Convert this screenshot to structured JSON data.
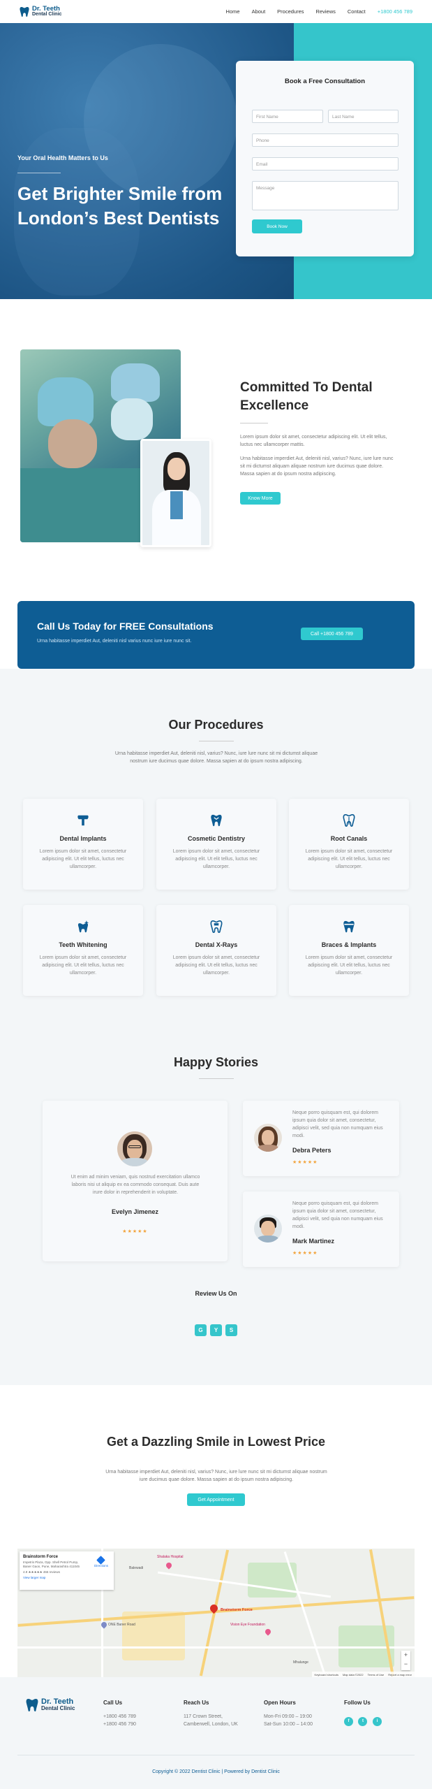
{
  "brand": {
    "name": "Dr. Teeth",
    "sub": "Dental Clinic"
  },
  "nav": {
    "items": [
      "Home",
      "About",
      "Procedures",
      "Reviews",
      "Contact"
    ],
    "phone": "+1800 456 789"
  },
  "hero": {
    "kicker": "Your Oral Health Matters to Us",
    "title": "Get Brighter Smile from London’s Best Dentists",
    "form": {
      "title": "Book a Free Consultation",
      "first_name": "First Name",
      "last_name": "Last Name",
      "phone": "Phone",
      "email": "Email",
      "message": "Message",
      "button": "Book Now"
    }
  },
  "commit": {
    "title": "Committed To Dental Excellence",
    "p1": "Lorem ipsum dolor sit amet, consectetur adipiscing elit. Ut elit tellus, luctus nec ullamcorper mattis.",
    "p2": "Urna habitasse imperdiet Aut, deleniti nisl, varius? Nunc, iure lure nunc sit mi dictumst aliquam aliquae nostrum iure ducimus quae dolore. Massa sapien at do ipsum nostra adipiscing.",
    "button": "Know More"
  },
  "cta": {
    "title": "Call Us Today for FREE Consultations",
    "sub": "Urna habitasse imperdiet Aut, deleniti nisl varius nunc iure iure nunc sit.",
    "button": "Call +1800 456 789"
  },
  "procedures": {
    "title": "Our Procedures",
    "sub": "Urna habitasse imperdiet Aut, deleniti nisl, varius? Nunc, iure lure nunc sit mi dictumst aliquae nostrum iure ducimus quae dolore. Massa sapien at do ipsum nostra adipiscing.",
    "items": [
      {
        "title": "Dental Implants",
        "text": "Lorem ipsum dolor sit amet, consectetur adipiscing elit. Ut elit tellus, luctus nec ullamcorper."
      },
      {
        "title": "Cosmetic Dentistry",
        "text": "Lorem ipsum dolor sit amet, consectetur adipiscing elit. Ut elit tellus, luctus nec ullamcorper."
      },
      {
        "title": "Root Canals",
        "text": "Lorem ipsum dolor sit amet, consectetur adipiscing elit. Ut elit tellus, luctus nec ullamcorper."
      },
      {
        "title": "Teeth Whitening",
        "text": "Lorem ipsum dolor sit amet, consectetur adipiscing elit. Ut elit tellus, luctus nec ullamcorper."
      },
      {
        "title": "Dental X-Rays",
        "text": "Lorem ipsum dolor sit amet, consectetur adipiscing elit. Ut elit tellus, luctus nec ullamcorper."
      },
      {
        "title": "Braces & Implants",
        "text": "Lorem ipsum dolor sit amet, consectetur adipiscing elit. Ut elit tellus, luctus nec ullamcorper."
      }
    ]
  },
  "stories": {
    "title": "Happy Stories",
    "main": {
      "quote": "Ut enim ad minim veniam, quis nostrud exercitation ullamco laboris nisi ut aliquip ex ea commodo consequat. Duis aute irure dolor in reprehenderit in voluptate.",
      "name": "Evelyn Jimenez",
      "stars": "★★★★★"
    },
    "side": [
      {
        "quote": "Neque porro quisquam est, qui dolorem ipsum quia dolor sit amet, consectetur, adipisci velit, sed quia non numquam eius modi.",
        "name": "Debra Peters",
        "stars": "★★★★★"
      },
      {
        "quote": "Neque porro quisquam est, qui dolorem ipsum quia dolor sit amet, consectetur, adipisci velit, sed quia non numquam eius modi.",
        "name": "Mark Martinez",
        "stars": "★★★★★"
      }
    ],
    "review_title": "Review Us On",
    "review_icons": [
      "G",
      "Y",
      "S"
    ]
  },
  "dazzle": {
    "title": "Get a Dazzling Smile in Lowest Price",
    "sub": "Urna habitasse imperdiet Aut, deleniti nisl, varius? Nunc, iure lure nunc sit mi dictumst aliquae nostrum iure ducimus quae dolore. Massa sapien at do ipsum nostra adipiscing.",
    "button": "Get Appointment"
  },
  "map": {
    "place": "Brainstorm Force",
    "address": "Impetris Plaza, Opp. Shell Petrol Pump, Baner Gaon, Pune, Maharashtra 411045",
    "rating": "4.9 ★★★★★  466 reviews",
    "larger": "View larger map",
    "directions": "Directions",
    "pin_label": "Brainstorm Force",
    "labels": [
      "Shalaka Hospital",
      "Balewadi",
      "ONE Baner Road",
      "Vision Eye Foundation",
      "Mhalunge"
    ],
    "footer": [
      "Keyboard shortcuts",
      "Map data ©2022",
      "Terms of Use",
      "Report a map error"
    ]
  },
  "footer": {
    "call": {
      "head": "Call Us",
      "lines": [
        "+1800 456 789",
        "+1800 456 790"
      ]
    },
    "reach": {
      "head": "Reach Us",
      "lines": [
        "117 Crown Street,",
        "Camberwell, London, UK"
      ]
    },
    "hours": {
      "head": "Open Hours",
      "lines": [
        "Mon-Fri 09:00 – 19:00",
        "Sat-Sun 10:00 – 14:00"
      ]
    },
    "follow": {
      "head": "Follow Us",
      "icons": [
        "f",
        "t",
        "i"
      ]
    },
    "copyright": "Copyright © 2022 Dentist Clinic | Powered by Dentist Clinic"
  },
  "colors": {
    "teal": "#2fc9cf",
    "navy": "#0e5d94",
    "hero_blue": "#1d5585"
  }
}
